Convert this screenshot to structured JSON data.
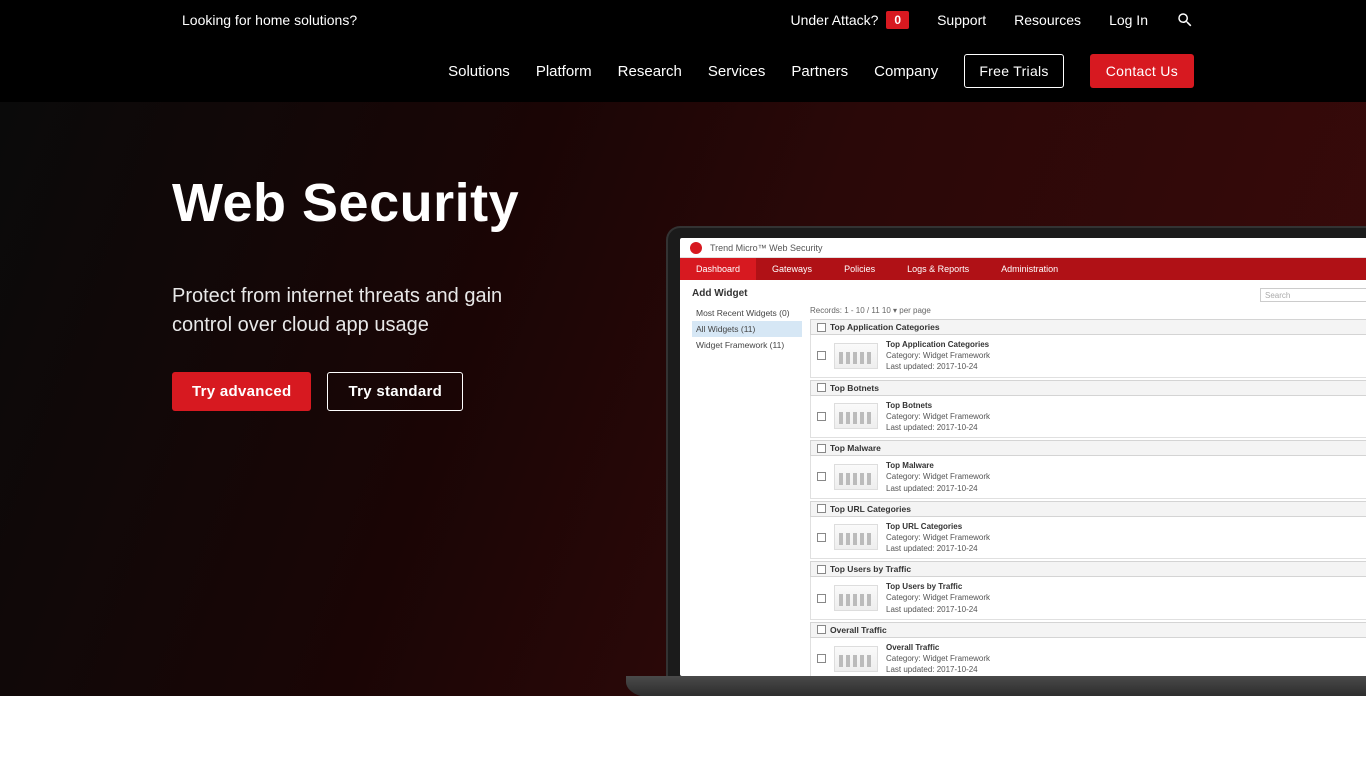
{
  "topbar": {
    "home_link": "Looking for home solutions?",
    "under_attack": "Under Attack?",
    "badge_count": "0",
    "support": "Support",
    "resources": "Resources",
    "login": "Log In"
  },
  "mainnav": {
    "items": [
      "Solutions",
      "Platform",
      "Research",
      "Services",
      "Partners",
      "Company"
    ],
    "free_trials": "Free Trials",
    "contact": "Contact Us"
  },
  "hero": {
    "title": "Web Security",
    "subtitle": "Protect from internet threats and gain control over cloud app usage",
    "cta_primary": "Try advanced",
    "cta_secondary": "Try standard"
  },
  "screen": {
    "brand": "Trend Micro™ Web Security",
    "menu": [
      "Dashboard",
      "Gateways",
      "Policies",
      "Logs & Reports",
      "Administration"
    ],
    "menu_active_index": 0,
    "add_widget": "Add Widget",
    "side": [
      {
        "label": "Most Recent Widgets (0)"
      },
      {
        "label": "All Widgets (11)",
        "selected": true
      },
      {
        "label": "Widget Framework (11)"
      }
    ],
    "search_placeholder": "Search",
    "search_close": "×",
    "pager": "Records: 1 - 10 / 11   10 ▾ per page",
    "groups": [
      {
        "head": "Top Application Categories",
        "title": "Top Application Categories",
        "category": "Category: Widget Framework",
        "updated": "Last updated: 2017-10-24"
      },
      {
        "head": "Top Botnets",
        "title": "Top Botnets",
        "category": "Category: Widget Framework",
        "updated": "Last updated: 2017-10-24"
      },
      {
        "head": "Top Malware",
        "title": "Top Malware",
        "category": "Category: Widget Framework",
        "updated": "Last updated: 2017-10-24"
      },
      {
        "head": "Top URL Categories",
        "title": "Top URL Categories",
        "category": "Category: Widget Framework",
        "updated": "Last updated: 2017-10-24"
      },
      {
        "head": "Top Users by Traffic",
        "title": "Top Users by Traffic",
        "category": "Category: Widget Framework",
        "updated": "Last updated: 2017-10-24"
      },
      {
        "head": "Overall Traffic",
        "title": "Overall Traffic",
        "category": "Category: Widget Framework",
        "updated": "Last updated: 2017-10-24"
      }
    ]
  },
  "colors": {
    "accent": "#d71920"
  }
}
